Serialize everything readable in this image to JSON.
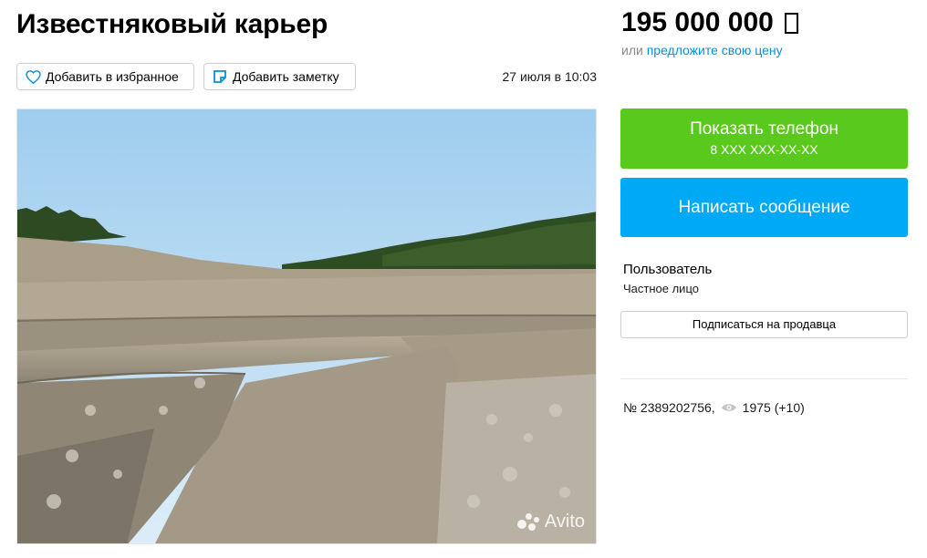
{
  "listing": {
    "title": "Известняковый карьер",
    "date": "27 июля в 10:03"
  },
  "actions": {
    "favorite_label": "Добавить в избранное",
    "note_label": "Добавить заметку"
  },
  "price": {
    "amount": "195 000 000",
    "currency_icon": "ruble-icon",
    "offer_prefix": "или",
    "offer_link": "предложите свою цену"
  },
  "contact": {
    "phone_label": "Показать телефон",
    "phone_masked": "8 XXX XXX-XX-XX",
    "message_label": "Написать сообщение"
  },
  "seller": {
    "name": "Пользователь",
    "type": "Частное лицо",
    "subscribe_label": "Подписаться на продавца"
  },
  "meta": {
    "listing_number": "№ 2389202756,",
    "views": "1975 (+10)"
  },
  "photo": {
    "watermark": "Avito"
  },
  "colors": {
    "green": "#59c91d",
    "blue": "#00a9f5",
    "link": "#0a8ed8"
  }
}
